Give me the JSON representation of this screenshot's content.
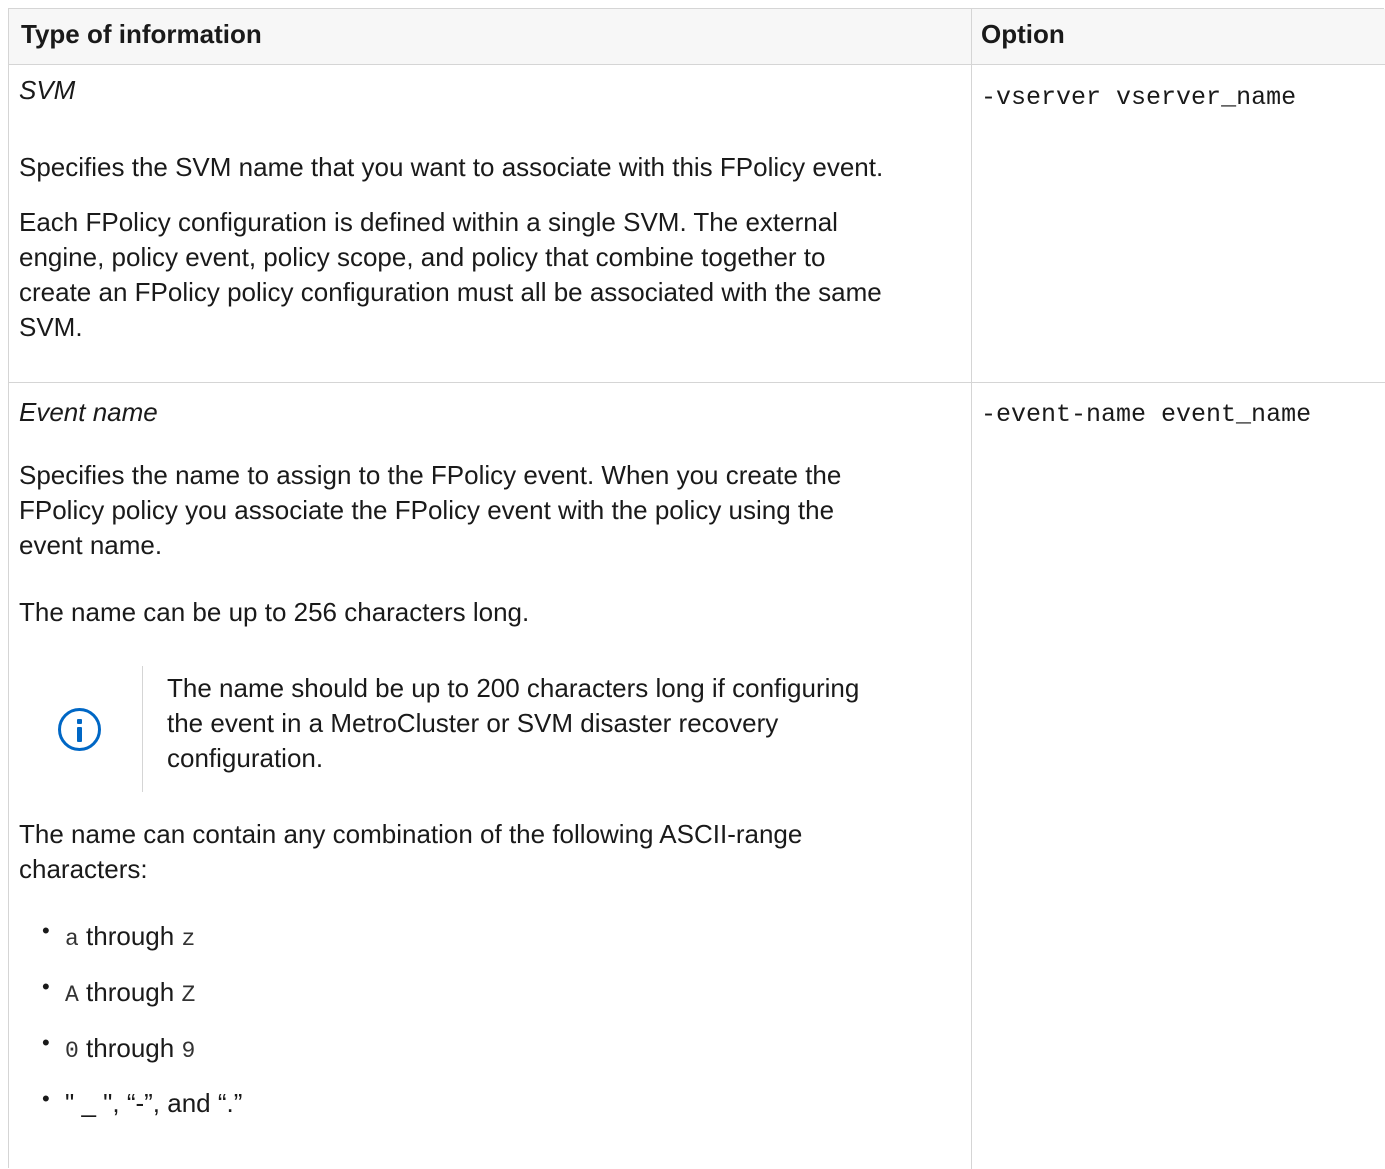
{
  "table": {
    "headers": {
      "type": "Type of information",
      "option": "Option"
    },
    "rows": [
      {
        "title": "SVM",
        "option_flag": "-vserver",
        "option_value": "vserver_name",
        "paragraphs": [
          "Specifies the SVM name that you want to associate with this FPolicy event.",
          "Each FPolicy configuration is defined within a single SVM. The external",
          "engine, policy event, policy scope, and policy that combine together to",
          "create an FPolicy policy configuration must all be associated with the same",
          "SVM."
        ]
      },
      {
        "title": "Event name",
        "option_flag": "-event-name",
        "option_value": "event_name",
        "paragraphs": [
          "Specifies the name to assign to the FPolicy event. When you create the",
          "FPolicy policy you associate the FPolicy event with the policy using the",
          "event name.",
          "The name can be up to 256 characters long."
        ],
        "note": {
          "icon": "info-icon",
          "lines": [
            "The name should be up to 200 characters long if configuring",
            "the event in a MetroCluster or SVM disaster recovery",
            "configuration."
          ]
        },
        "chars_intro": [
          "The name can contain any combination of the following ASCII-range",
          "characters:"
        ],
        "list": [
          {
            "from": "a",
            "through": "through",
            "to": "z"
          },
          {
            "from": "A",
            "through": "through",
            "to": "Z"
          },
          {
            "from": "0",
            "through": "through",
            "to": "9"
          },
          {
            "text": "\" _ \", “-”, and “.”"
          }
        ]
      }
    ]
  },
  "colors": {
    "border": "#d5d5d5",
    "header_bg": "#f7f7f7",
    "icon": "#0067c5"
  }
}
